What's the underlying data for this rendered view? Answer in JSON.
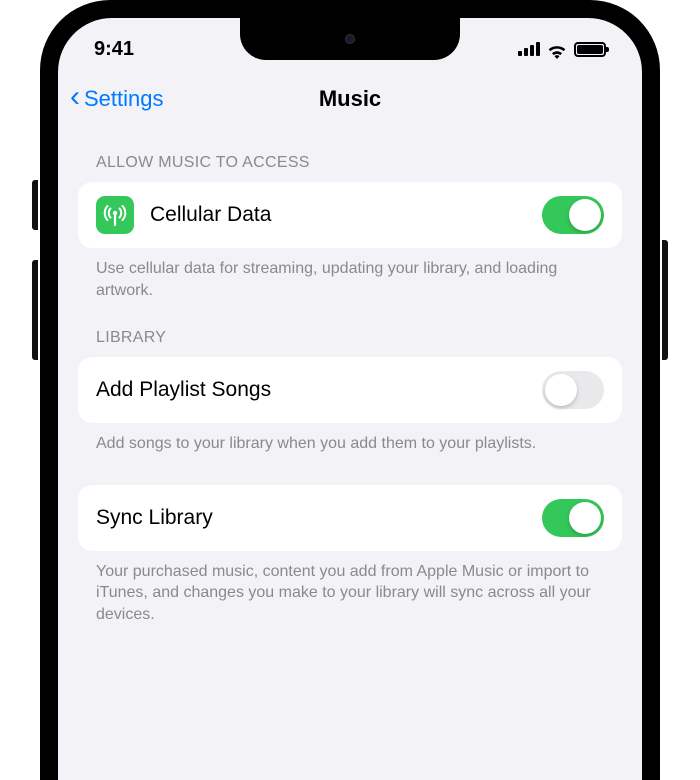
{
  "status": {
    "time": "9:41"
  },
  "nav": {
    "back": "Settings",
    "title": "Music"
  },
  "sections": {
    "access": {
      "header": "ALLOW MUSIC TO ACCESS",
      "row_label": "Cellular Data",
      "toggle_on": true,
      "footer": "Use cellular data for streaming, updating your library, and loading artwork."
    },
    "library": {
      "header": "LIBRARY",
      "add_playlist": {
        "label": "Add Playlist Songs",
        "toggle_on": false,
        "footer": "Add songs to your library when you add them to your playlists."
      },
      "sync": {
        "label": "Sync Library",
        "toggle_on": true,
        "footer": "Your purchased music, content you add from Apple Music or import to iTunes, and changes you make to your library will sync across all your devices."
      }
    }
  }
}
